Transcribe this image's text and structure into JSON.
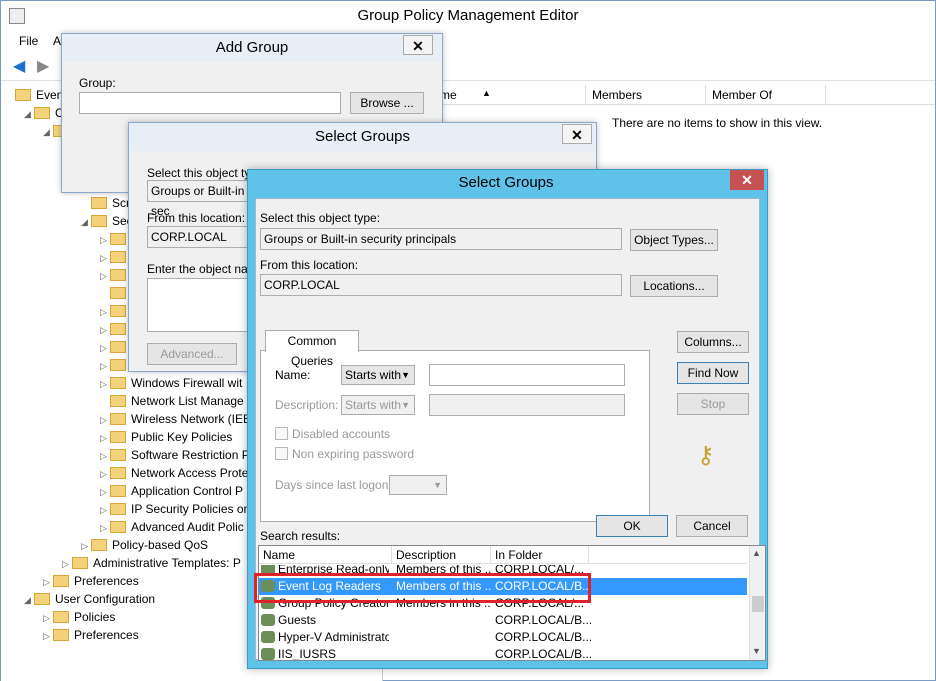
{
  "main": {
    "title": "Group Policy Management Editor",
    "menu": [
      "File",
      "A"
    ],
    "columns": [
      "me",
      "Members",
      "Member Of"
    ],
    "empty_text": "There are no items to show in this view."
  },
  "tree": [
    {
      "label": "Event",
      "indent": 0,
      "tri": ""
    },
    {
      "label": "C",
      "indent": 1,
      "tri": "◢"
    },
    {
      "label": "",
      "indent": 2,
      "tri": "◢"
    },
    {
      "label": "",
      "indent": 3,
      "tri": ""
    },
    {
      "label": "",
      "indent": 3,
      "tri": ""
    },
    {
      "label": "",
      "indent": 3,
      "tri": ""
    },
    {
      "label": "Scri",
      "indent": 4,
      "tri": ""
    },
    {
      "label": "Sec",
      "indent": 4,
      "tri": "◢"
    },
    {
      "label": "",
      "indent": 5,
      "tri": "▷"
    },
    {
      "label": "",
      "indent": 5,
      "tri": "▷"
    },
    {
      "label": "",
      "indent": 5,
      "tri": "▷"
    },
    {
      "label": "",
      "indent": 5,
      "tri": ""
    },
    {
      "label": "",
      "indent": 5,
      "tri": "▷"
    },
    {
      "label": "",
      "indent": 5,
      "tri": "▷"
    },
    {
      "label": "",
      "indent": 5,
      "tri": "▷"
    },
    {
      "label": "",
      "indent": 5,
      "tri": "▷"
    },
    {
      "label": "Windows Firewall wit",
      "indent": 5,
      "tri": "▷"
    },
    {
      "label": "Network List Manage",
      "indent": 5,
      "tri": ""
    },
    {
      "label": "Wireless Network (IEE",
      "indent": 5,
      "tri": "▷"
    },
    {
      "label": "Public Key Policies",
      "indent": 5,
      "tri": "▷"
    },
    {
      "label": "Software Restriction P",
      "indent": 5,
      "tri": "▷"
    },
    {
      "label": "Network Access Prote",
      "indent": 5,
      "tri": "▷"
    },
    {
      "label": "Application Control P",
      "indent": 5,
      "tri": "▷"
    },
    {
      "label": "IP Security Policies on",
      "indent": 5,
      "tri": "▷"
    },
    {
      "label": "Advanced Audit Polic",
      "indent": 5,
      "tri": "▷"
    },
    {
      "label": "Policy-based QoS",
      "indent": 4,
      "tri": "▷"
    },
    {
      "label": "Administrative Templates: P",
      "indent": 3,
      "tri": "▷"
    },
    {
      "label": "Preferences",
      "indent": 2,
      "tri": "▷"
    },
    {
      "label": "User Configuration",
      "indent": 1,
      "tri": "◢"
    },
    {
      "label": "Policies",
      "indent": 2,
      "tri": "▷"
    },
    {
      "label": "Preferences",
      "indent": 2,
      "tri": "▷"
    }
  ],
  "add_group": {
    "title": "Add Group",
    "group_label": "Group:",
    "browse": "Browse ..."
  },
  "select_groups_back": {
    "title": "Select Groups",
    "object_type_label": "Select this object typ",
    "object_type_value": "Groups or Built-in sec",
    "location_label": "From this location:",
    "location_value": "CORP.LOCAL",
    "enter_label": "Enter the object nan",
    "advanced": "Advanced..."
  },
  "select_groups": {
    "title": "Select Groups",
    "object_type_label": "Select this object type:",
    "object_type_value": "Groups or Built-in security principals",
    "object_types_btn": "Object Types...",
    "location_label": "From this location:",
    "location_value": "CORP.LOCAL",
    "locations_btn": "Locations...",
    "tab": "Common Queries",
    "name_label": "Name:",
    "name_mode": "Starts with",
    "desc_label": "Description:",
    "desc_mode": "Starts with",
    "disabled_accounts": "Disabled accounts",
    "non_expiring": "Non expiring password",
    "days_label": "Days since last logon:",
    "columns_btn": "Columns...",
    "find_now_btn": "Find Now",
    "stop_btn": "Stop",
    "ok_btn": "OK",
    "cancel_btn": "Cancel",
    "results_label": "Search results:",
    "result_columns": [
      "Name",
      "Description",
      "In Folder"
    ],
    "results": [
      {
        "name": "Enterprise Read-only ...",
        "desc": "Members of this ...",
        "folder": "CORP.LOCAL/..."
      },
      {
        "name": "Event Log Readers",
        "desc": "Members of this ...",
        "folder": "CORP.LOCAL/B..."
      },
      {
        "name": "Group Policy Creator ...",
        "desc": "Members in this ...",
        "folder": "CORP.LOCAL/..."
      },
      {
        "name": "Guests",
        "desc": "",
        "folder": "CORP.LOCAL/B..."
      },
      {
        "name": "Hyper-V Administrators",
        "desc": "",
        "folder": "CORP.LOCAL/B..."
      },
      {
        "name": "IIS_IUSRS",
        "desc": "",
        "folder": "CORP.LOCAL/B..."
      }
    ],
    "selected_index": 1
  },
  "colors": {
    "accent": "#5fc2e8",
    "selection": "#3399ff",
    "highlight": "#e0202a"
  }
}
